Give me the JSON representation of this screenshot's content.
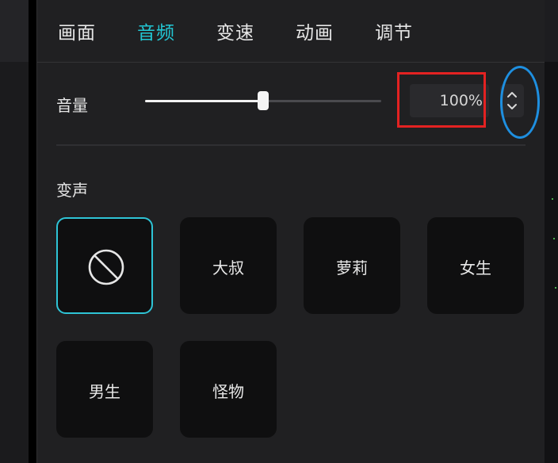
{
  "tabs": [
    {
      "label": "画面",
      "active": false
    },
    {
      "label": "音频",
      "active": true
    },
    {
      "label": "变速",
      "active": false
    },
    {
      "label": "动画",
      "active": false
    },
    {
      "label": "调节",
      "active": false
    }
  ],
  "volume": {
    "label": "音量",
    "value_text": "100%",
    "slider_fraction": 0.5
  },
  "voice_change": {
    "label": "变声",
    "options": [
      {
        "label": "",
        "icon": "none-icon",
        "selected": true
      },
      {
        "label": "大叔",
        "selected": false
      },
      {
        "label": "萝莉",
        "selected": false
      },
      {
        "label": "女生",
        "selected": false
      },
      {
        "label": "男生",
        "selected": false
      },
      {
        "label": "怪物",
        "selected": false
      }
    ]
  },
  "colors": {
    "accent": "#22c7d4",
    "panel_bg": "#202022",
    "tile_bg": "#0f0f10",
    "annotation_red": "#e32222",
    "annotation_blue": "#1e8fe0"
  }
}
